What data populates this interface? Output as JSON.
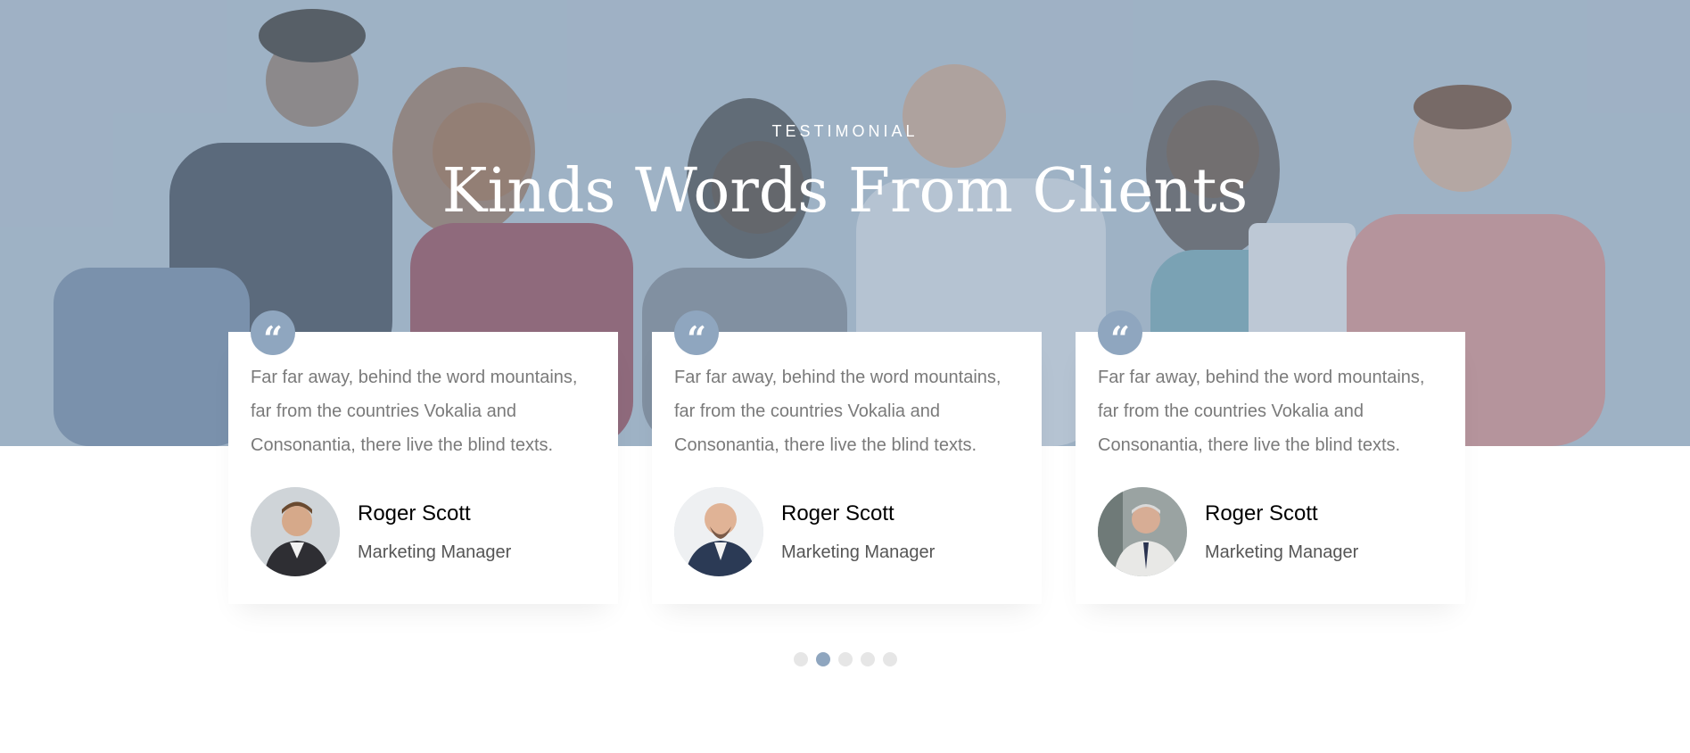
{
  "hero": {
    "subheading": "TESTIMONIAL",
    "heading": "Kinds Words From Clients"
  },
  "colors": {
    "accent": "#8fa6bf",
    "hero_overlay": "#a3b5c7",
    "dot_inactive": "#e6e6e6"
  },
  "testimonials": [
    {
      "quote_icon": "quote-left-icon",
      "text": "Far far away, behind the word mountains, far from the countries Vokalia and Consonantia, there live the blind texts.",
      "name": "Roger Scott",
      "position": "Marketing Manager"
    },
    {
      "quote_icon": "quote-left-icon",
      "text": "Far far away, behind the word mountains, far from the countries Vokalia and Consonantia, there live the blind texts.",
      "name": "Roger Scott",
      "position": "Marketing Manager"
    },
    {
      "quote_icon": "quote-left-icon",
      "text": "Far far away, behind the word mountains, far from the countries Vokalia and Consonantia, there live the blind texts.",
      "name": "Roger Scott",
      "position": "Marketing Manager"
    }
  ],
  "carousel": {
    "dot_count": 5,
    "active_index": 1
  }
}
